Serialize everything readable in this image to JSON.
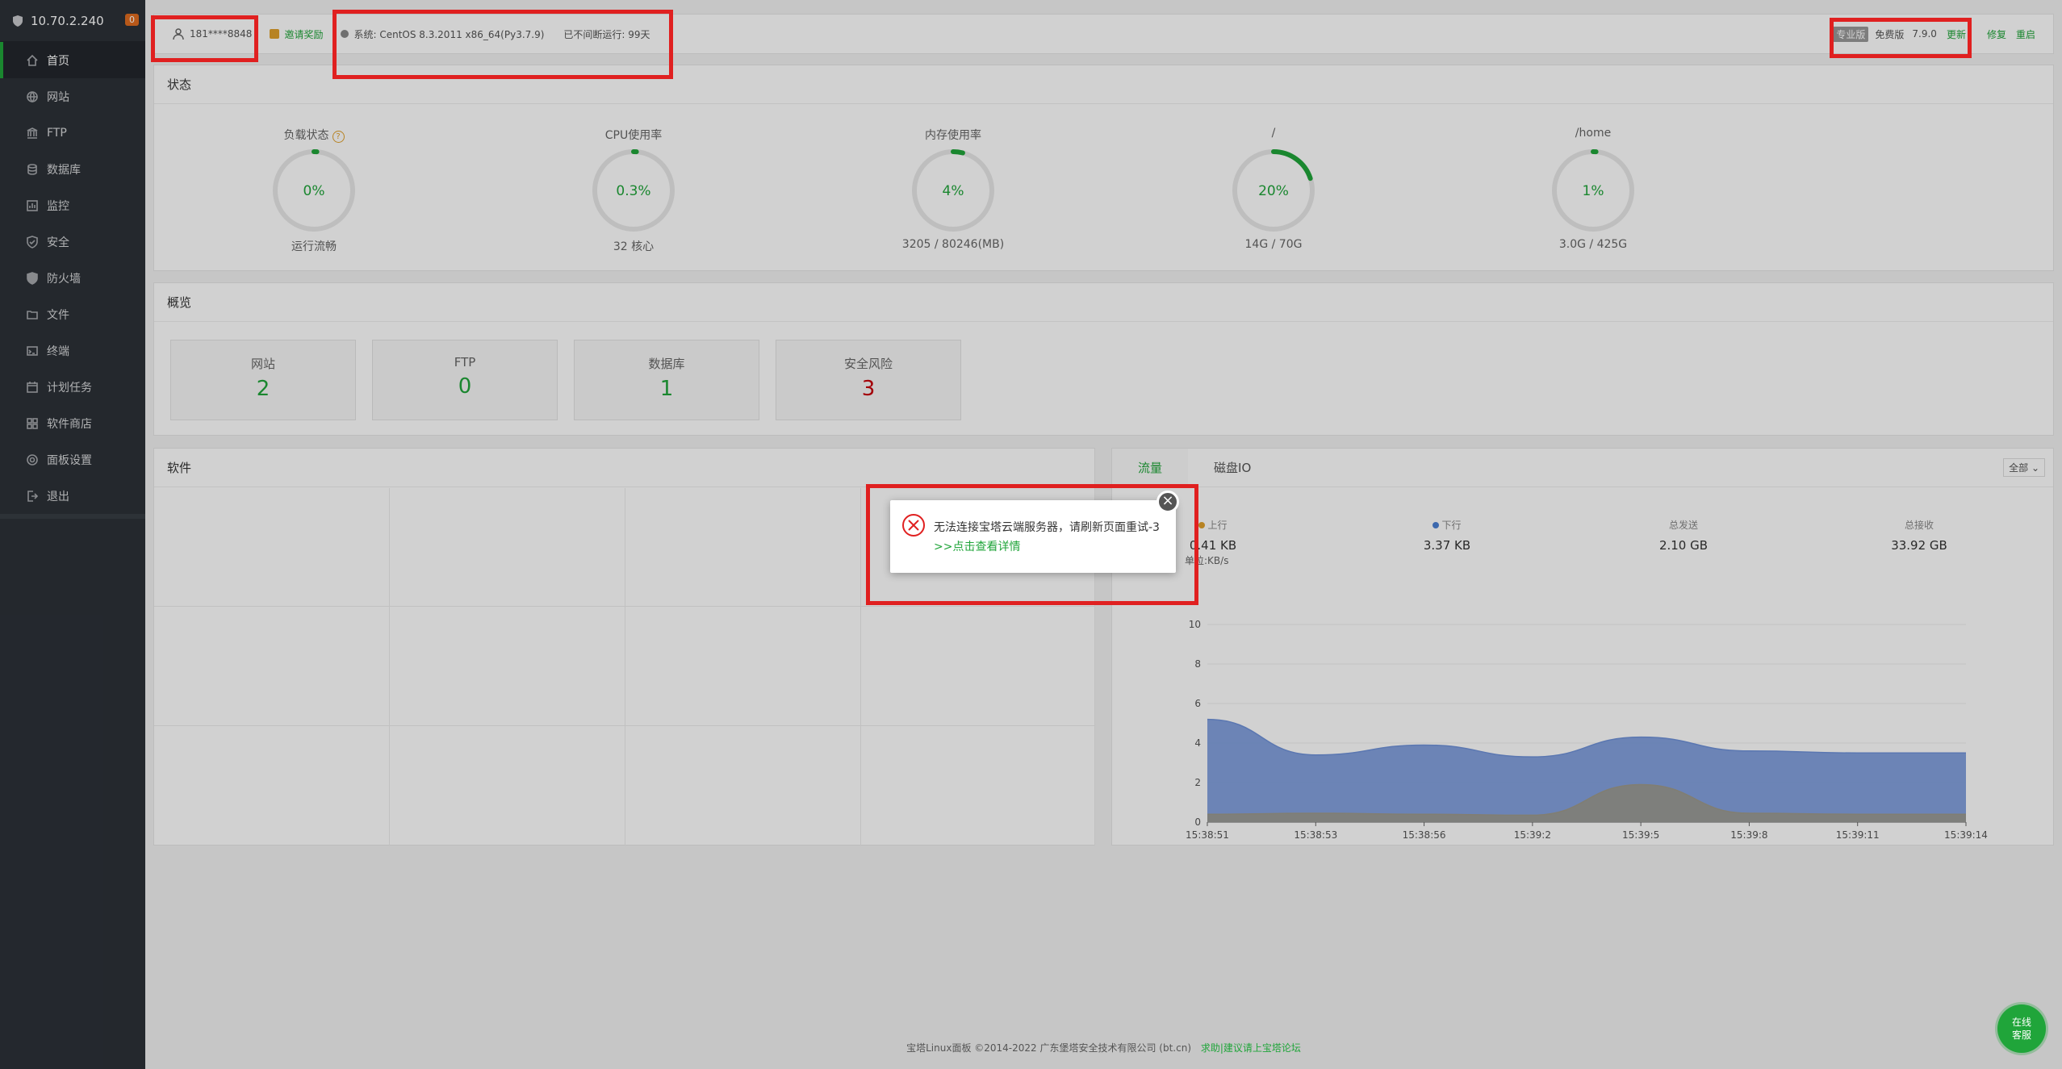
{
  "sidebar": {
    "host": "10.70.2.240",
    "badge": "0",
    "items": [
      {
        "label": "首页",
        "icon": "home-icon"
      },
      {
        "label": "网站",
        "icon": "globe-icon"
      },
      {
        "label": "FTP",
        "icon": "ftp-icon"
      },
      {
        "label": "数据库",
        "icon": "database-icon"
      },
      {
        "label": "监控",
        "icon": "monitor-icon"
      },
      {
        "label": "安全",
        "icon": "shield-icon"
      },
      {
        "label": "防火墙",
        "icon": "firewall-icon"
      },
      {
        "label": "文件",
        "icon": "folder-icon"
      },
      {
        "label": "终端",
        "icon": "terminal-icon"
      },
      {
        "label": "计划任务",
        "icon": "calendar-icon"
      },
      {
        "label": "软件商店",
        "icon": "apps-icon"
      },
      {
        "label": "面板设置",
        "icon": "settings-icon"
      },
      {
        "label": "退出",
        "icon": "logout-icon"
      }
    ]
  },
  "topbar": {
    "user": "181****8848",
    "invite": "邀请奖励",
    "system": "系统:   CentOS 8.3.2011 x86_64(Py3.7.9)",
    "uptime": "已不间断运行: 99天",
    "pro": "专业版",
    "free": "免费版",
    "version": "7.9.0",
    "update": "更新",
    "repair": "修复",
    "restart": "重启"
  },
  "status": {
    "title": "状态",
    "gauges": [
      {
        "title": "负载状态",
        "value": "0%",
        "sub": "运行流畅",
        "pct": 0,
        "help": "?"
      },
      {
        "title": "CPU使用率",
        "value": "0.3%",
        "sub": "32 核心",
        "pct": 0.3
      },
      {
        "title": "内存使用率",
        "value": "4%",
        "sub": "3205 / 80246(MB)",
        "pct": 4
      },
      {
        "title": "/",
        "value": "20%",
        "sub": "14G / 70G",
        "pct": 20
      },
      {
        "title": "/home",
        "value": "1%",
        "sub": "3.0G / 425G",
        "pct": 1
      }
    ]
  },
  "overview": {
    "title": "概览",
    "cards": [
      {
        "label": "网站",
        "value": "2"
      },
      {
        "label": "FTP",
        "value": "0"
      },
      {
        "label": "数据库",
        "value": "1"
      },
      {
        "label": "安全风险",
        "value": "3"
      }
    ]
  },
  "software": {
    "title": "软件"
  },
  "network": {
    "tabs": [
      "流量",
      "磁盘IO"
    ],
    "select": "全部",
    "stats": [
      {
        "label": "上行",
        "value": "0.41 KB",
        "color": "#e0a02b"
      },
      {
        "label": "下行",
        "value": "3.37 KB",
        "color": "#4a7fd4"
      },
      {
        "label": "总发送",
        "value": "2.10 GB"
      },
      {
        "label": "总接收",
        "value": "33.92 GB"
      }
    ],
    "unit": "单位:KB/s"
  },
  "chart_data": {
    "type": "area",
    "x": [
      "15:38:51",
      "15:38:53",
      "15:38:56",
      "15:39:2",
      "15:39:5",
      "15:39:8",
      "15:39:11",
      "15:39:14"
    ],
    "ylabel": "单位:KB/s",
    "ylim": [
      0,
      12
    ],
    "yticks": [
      0,
      2,
      4,
      6,
      8,
      10
    ],
    "series": [
      {
        "name": "下行",
        "color": "#6f92d8",
        "values": [
          5.2,
          3.4,
          3.9,
          3.3,
          4.3,
          3.6,
          3.5,
          3.5
        ]
      },
      {
        "name": "上行",
        "color": "#9e9a8c",
        "values": [
          0.4,
          0.45,
          0.4,
          0.35,
          1.9,
          0.45,
          0.4,
          0.4
        ]
      }
    ]
  },
  "dialog": {
    "message": "无法连接宝塔云端服务器，请刷新页面重试-3",
    "link": ">>点击查看详情",
    "close": "×"
  },
  "footer": {
    "text": "宝塔Linux面板 ©2014-2022 广东堡塔安全技术有限公司 (bt.cn)",
    "link": "求助|建议请上宝塔论坛"
  },
  "kefu": {
    "line1": "在线",
    "line2": "客服"
  }
}
